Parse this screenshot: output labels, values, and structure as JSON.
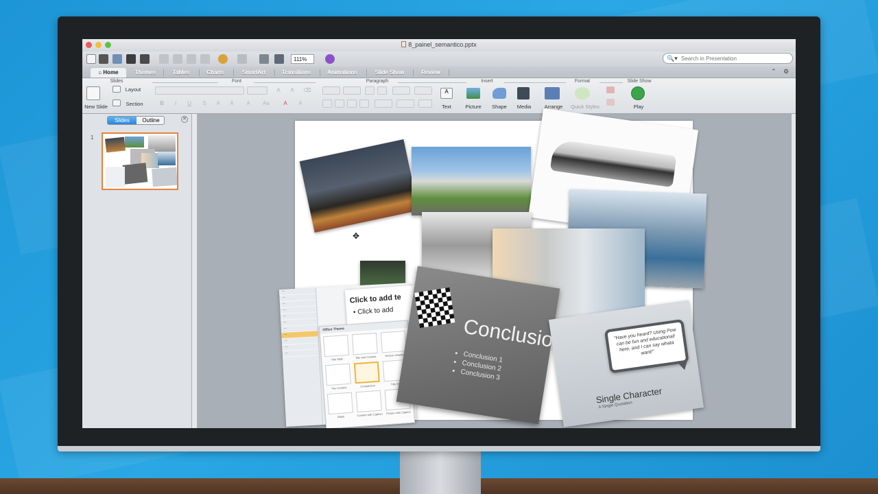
{
  "window": {
    "title": "8_painel_semantico.pptx"
  },
  "standard_toolbar": {
    "zoom": "111%"
  },
  "search": {
    "placeholder": "Search in Presentation"
  },
  "tabs": [
    {
      "label": "Home",
      "active": true
    },
    {
      "label": "Themes"
    },
    {
      "label": "Tables"
    },
    {
      "label": "Charts"
    },
    {
      "label": "SmartArt"
    },
    {
      "label": "Transitions"
    },
    {
      "label": "Animations"
    },
    {
      "label": "Slide Show"
    },
    {
      "label": "Review"
    }
  ],
  "ribbon": {
    "groups": [
      "Slides",
      "Font",
      "Paragraph",
      "Insert",
      "Format",
      "Slide Show"
    ],
    "slides": {
      "new_slide": "New Slide",
      "layout": "Layout",
      "section": "Section"
    },
    "insert": [
      "Text",
      "Picture",
      "Shape",
      "Media"
    ],
    "format": [
      "Arrange",
      "Quick Styles"
    ],
    "slideshow": {
      "play": "Play"
    }
  },
  "pane": {
    "tab_slides": "Slides",
    "tab_outline": "Outline",
    "slide_number": "1"
  },
  "slide": {
    "conclusion_title": "Conclusion",
    "conclusion_bullets": [
      "Conclusion 1",
      "Conclusion 2",
      "Conclusion 3"
    ],
    "click_title": "Click to add te",
    "click_bullet": "Click to add",
    "office_theme": "Office Theme",
    "layout_labels": [
      "Title Slide",
      "Title and Content",
      "Section Header",
      "Two Content",
      "Comparison",
      "Title Only",
      "Blank",
      "Content with Caption",
      "Picture with Caption"
    ],
    "quote": "\"Have you heard? Using Pow can be fun and educational! here, and I can say whata want!\"",
    "single_title": "Single Character",
    "single_subtitle": "A Single Quotation"
  },
  "colors": {
    "accent": "#e8823c",
    "tab_active": "#eef0f2",
    "play_green": "#3aa54a"
  }
}
